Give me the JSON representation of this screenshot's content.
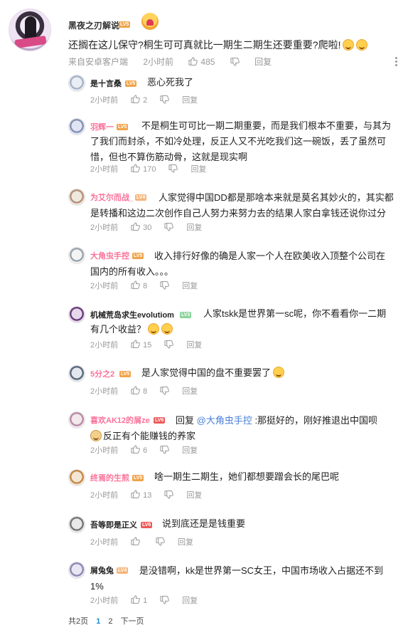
{
  "main_comment": {
    "user": "黑夜之刃解说",
    "level": "LV5",
    "level_color": "#f0a34a",
    "text": "还搁在这儿保守?桐生可可真就比一期生二期生还要重要?爬啦!",
    "emoji": [
      "smiley-icon",
      "smiley-icon"
    ],
    "source": "来自安卓客户端",
    "time": "2小时前",
    "likes": "485",
    "reply_label": "回复"
  },
  "replies": [
    {
      "user": "是十言桑",
      "name_color": "#222222",
      "level": "LV5",
      "level_color": "#f0a34a",
      "text_lines": [
        "恶心死我了"
      ],
      "time": "2小时前",
      "likes": "2",
      "reply_label": "回复"
    },
    {
      "user": "羽辉一",
      "name_color": "#fb7299",
      "level": "LV5",
      "level_color": "#f0a34a",
      "text_lines": [
        "不是桐生可可比一期二期重要，而是我们根本不重要，与其为",
        "了我们而封杀，不如冷处理，反正人又不光吃我们这一碗饭，丢了虽然可",
        "惜，但也不算伤筋动骨，这就是现实啊"
      ],
      "time": "2小时前",
      "likes": "170",
      "reply_label": "回复"
    },
    {
      "user": "为艾尔而战_",
      "name_color": "#fb7299",
      "level": "LV4",
      "level_color": "#f7b57b",
      "text_lines": [
        "人家觉得中国DD都是那啥本来就是莫名其妙火的，其实都",
        "是转播和这边二次创作自己人努力来努力去的结果人家白拿钱还说你过分"
      ],
      "time": "2小时前",
      "likes": "30",
      "reply_label": "回复"
    },
    {
      "user": "大角虫手控",
      "name_color": "#fb7299",
      "level": "LV5",
      "level_color": "#f0a34a",
      "text_lines": [
        "收入排行好像的确是人家一个人在欧美收入顶整个公司在",
        "国内的所有收入。。。"
      ],
      "time": "2小时前",
      "likes": "8",
      "reply_label": "回复"
    },
    {
      "user": "机械荒岛求生evolutiom",
      "name_color": "#222222",
      "level": "LV3",
      "level_color": "#8bd29a",
      "text_lines": [
        "人家tskk是世界第一sc呢，你不看看你一二期",
        "有几个收益？"
      ],
      "time": "2小时前",
      "likes": "15",
      "reply_label": "回复"
    },
    {
      "user": "5分之2",
      "name_color": "#fb7299",
      "level": "LV5",
      "level_color": "#f0a34a",
      "text_lines": [
        "是人家觉得中国的盘不重要罢了"
      ],
      "time": "2小时前",
      "likes": "8",
      "reply_label": "回复"
    },
    {
      "user": "喜欢AK12的屑ze",
      "name_color": "#fb7299",
      "level": "LV6",
      "level_color": "#ee5a5a",
      "text_prefix": "回复 ",
      "mention": "@大角虫手控",
      "text_after": " :那挺好的，刚好推退出中国呗",
      "text_line2": "反正有个能赚钱的养家",
      "time": "2小时前",
      "likes": "6",
      "reply_label": "回复"
    },
    {
      "user": "终焉的生煎",
      "name_color": "#fb7299",
      "level": "LV5",
      "level_color": "#f0a34a",
      "text_lines": [
        "啥一期生二期生，她们都想要蹭会长的尾巴呢"
      ],
      "time": "2小时前",
      "likes": "13",
      "reply_label": "回复"
    },
    {
      "user": "吾等即是正义",
      "name_color": "#222222",
      "level": "LV6",
      "level_color": "#ee5a5a",
      "text_lines": [
        "说到底还是是钱重要"
      ],
      "time": "2小时前",
      "likes": "",
      "reply_label": "回复"
    },
    {
      "user": "屑兔兔",
      "name_color": "#222222",
      "level": "LV4",
      "level_color": "#f7b57b",
      "text_lines": [
        "是没错啊，kk是世界第一SC女王，中国市场收入占据还不到",
        "1%"
      ],
      "time": "2小时前",
      "likes": "1",
      "reply_label": "回复"
    }
  ],
  "pagination": {
    "total": "共2页",
    "pages": [
      "1",
      "2"
    ],
    "current": "1",
    "next": "下一页"
  }
}
